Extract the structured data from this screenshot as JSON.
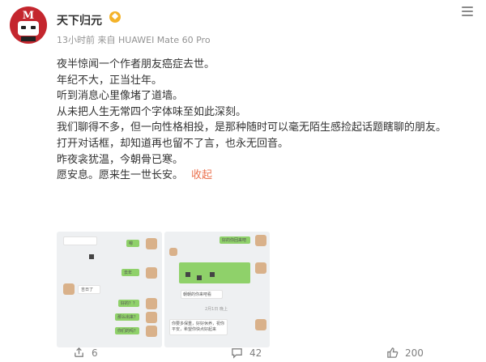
{
  "header": {
    "avatar_letter": "M",
    "username": "天下归元",
    "meta": "13小时前  来自 HUAWEI Mate 60 Pro",
    "badge": "verified-crown-badge"
  },
  "post": {
    "lines": [
      "夜半惊闻一个作者朋友癌症去世。",
      "年纪不大，正当壮年。",
      "听到消息心里像堵了道墙。",
      "从未把人生无常四个字体味至如此深刻。",
      "我们聊得不多，但一向性格相投，是那种随时可以毫无陌生感捡起话题瞎聊的朋友。",
      "打开对话框，却知道再也留不了言，也永无回音。",
      "昨夜衾犹温，今朝骨已寒。",
      "愿安息。愿来生一世长安。"
    ],
    "collapse_label": "收起"
  },
  "screenshot1": {
    "bubbles": [
      "嗯",
      "去年",
      "吉日了",
      "好的？？",
      "那么出来？",
      "你们的吗？"
    ]
  },
  "screenshot2": {
    "bubbles": [
      "好的你回来吧",
      "朝朝的你来吧看",
      "你要多保重，好好休养，祝你平安，希望你快点好起来"
    ],
    "timestamp": "2月1日 晚上"
  },
  "footer": {
    "share_count": "6",
    "comment_count": "42",
    "like_count": "200"
  },
  "colors": {
    "accent": "#eb7350",
    "avatar_red": "#c4262e",
    "wechat_green": "#8fd16a"
  }
}
